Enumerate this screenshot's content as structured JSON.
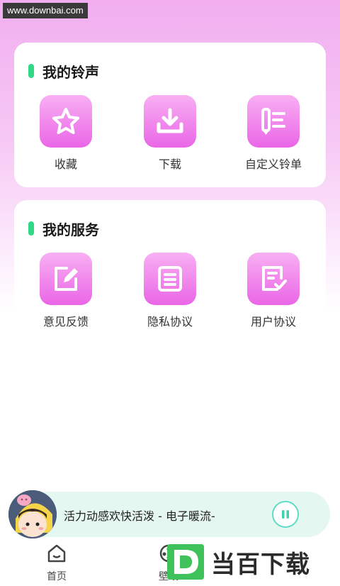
{
  "watermark": "www.downbai.com",
  "ringtone_section": {
    "title": "我的铃声",
    "items": [
      {
        "label": "收藏",
        "icon": "star-icon"
      },
      {
        "label": "下载",
        "icon": "download-icon"
      },
      {
        "label": "自定义铃单",
        "icon": "playlist-icon"
      }
    ]
  },
  "service_section": {
    "title": "我的服务",
    "items": [
      {
        "label": "意见反馈",
        "icon": "edit-icon"
      },
      {
        "label": "隐私协议",
        "icon": "document-icon"
      },
      {
        "label": "用户协议",
        "icon": "checklist-icon"
      }
    ]
  },
  "player": {
    "song": "活力动感欢快活泼 - 电子暖流-",
    "play_icon": "pause-icon"
  },
  "tabbar": {
    "tabs": [
      {
        "label": "首页",
        "icon": "home-icon"
      },
      {
        "label": "壁纸",
        "icon": "wallpaper-icon"
      }
    ]
  },
  "brand": {
    "text": "当百下载",
    "logo": "d-logo-icon"
  },
  "colors": {
    "accent_green": "#31d987",
    "icon_pink": "#ea66e6",
    "player_bg": "#e5f7f1"
  }
}
